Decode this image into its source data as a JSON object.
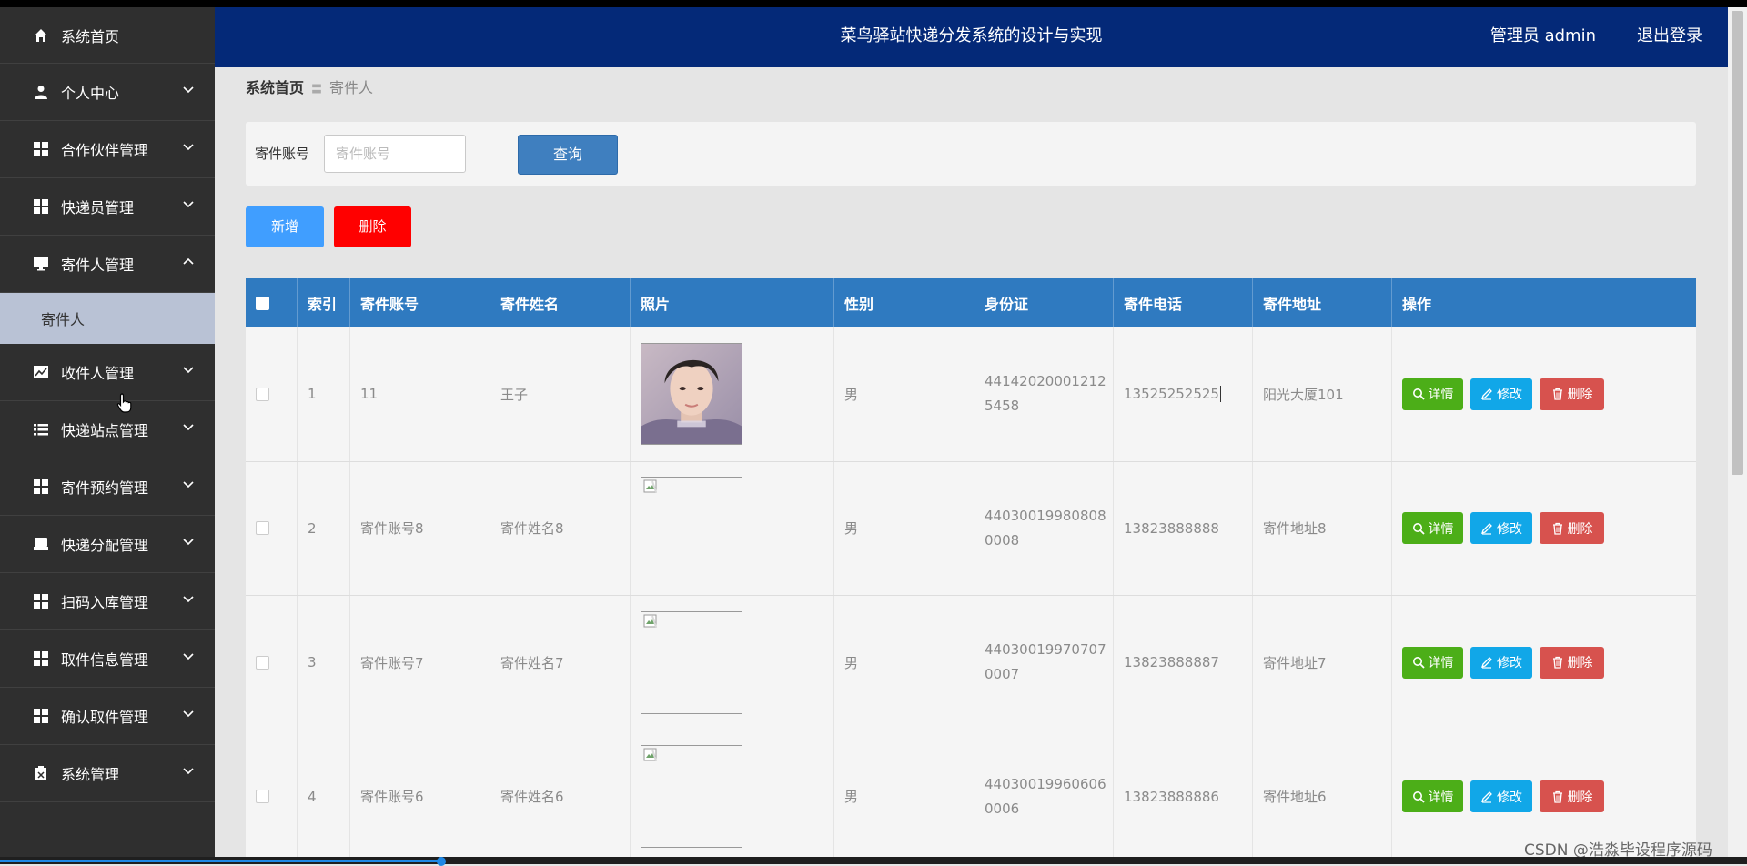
{
  "header": {
    "title": "菜鸟驿站快递分发系统的设计与实现",
    "admin": "管理员 admin",
    "logout": "退出登录"
  },
  "sidebar": {
    "items": [
      {
        "label": "系统首页",
        "icon": "home-icon"
      },
      {
        "label": "个人中心",
        "icon": "user-icon"
      },
      {
        "label": "合作伙伴管理",
        "icon": "grid-icon"
      },
      {
        "label": "快递员管理",
        "icon": "grid-icon"
      },
      {
        "label": "寄件人管理",
        "icon": "monitor-icon",
        "expanded": true
      },
      {
        "label": "收件人管理",
        "icon": "chart-icon"
      },
      {
        "label": "快递站点管理",
        "icon": "list-icon"
      },
      {
        "label": "寄件预约管理",
        "icon": "grid-icon"
      },
      {
        "label": "快递分配管理",
        "icon": "box-icon"
      },
      {
        "label": "扫码入库管理",
        "icon": "grid-icon"
      },
      {
        "label": "取件信息管理",
        "icon": "grid-icon"
      },
      {
        "label": "确认取件管理",
        "icon": "grid-icon"
      },
      {
        "label": "系统管理",
        "icon": "clipboard-icon"
      }
    ],
    "subitem": "寄件人"
  },
  "breadcrumb": {
    "home": "系统首页",
    "sep": "〓",
    "current": "寄件人"
  },
  "search": {
    "label": "寄件账号",
    "placeholder": "寄件账号",
    "value": "",
    "button": "查询"
  },
  "toolbar": {
    "add": "新增",
    "delete": "删除"
  },
  "table": {
    "columns": [
      "",
      "索引",
      "寄件账号",
      "寄件姓名",
      "照片",
      "性别",
      "身份证",
      "寄件电话",
      "寄件地址",
      "操作"
    ],
    "rows": [
      {
        "index": "1",
        "account": "11",
        "name": "王子",
        "gender": "男",
        "id1": "44142020001212",
        "id2": "5458",
        "phone": "13525252525",
        "address": "阳光大厦101"
      },
      {
        "index": "2",
        "account": "寄件账号8",
        "name": "寄件姓名8",
        "gender": "男",
        "id1": "44030019980808",
        "id2": "0008",
        "phone": "13823888888",
        "address": "寄件地址8"
      },
      {
        "index": "3",
        "account": "寄件账号7",
        "name": "寄件姓名7",
        "gender": "男",
        "id1": "44030019970707",
        "id2": "0007",
        "phone": "13823888887",
        "address": "寄件地址7"
      },
      {
        "index": "4",
        "account": "寄件账号6",
        "name": "寄件姓名6",
        "gender": "男",
        "id1": "44030019960606",
        "id2": "0006",
        "phone": "13823888886",
        "address": "寄件地址6"
      }
    ],
    "actions": {
      "detail": "详情",
      "edit": "修改",
      "remove": "删除"
    }
  },
  "watermark": "CSDN @浩淼毕设程序源码"
}
